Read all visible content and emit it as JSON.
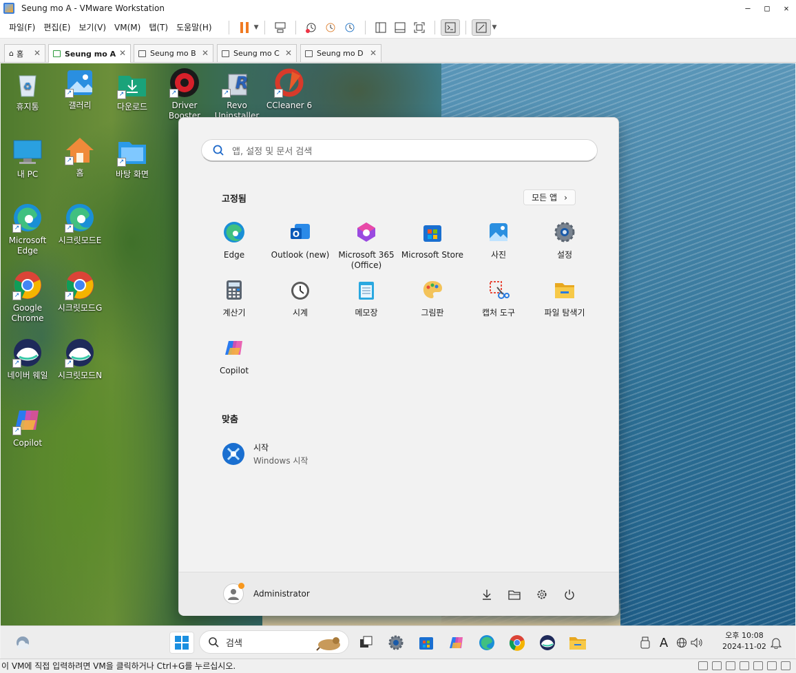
{
  "window": {
    "title": "Seung mo A - VMware Workstation"
  },
  "menu": [
    "파일(F)",
    "편집(E)",
    "보기(V)",
    "VM(M)",
    "탭(T)",
    "도움말(H)"
  ],
  "tabs": [
    {
      "label": "홈",
      "active": false
    },
    {
      "label": "Seung mo A",
      "active": true
    },
    {
      "label": "Seung mo B",
      "active": false
    },
    {
      "label": "Seung mo C",
      "active": false
    },
    {
      "label": "Seung mo D",
      "active": false
    }
  ],
  "desktop_icons": [
    {
      "label": "휴지통",
      "icon": "recycle-bin-icon"
    },
    {
      "label": "갤러리",
      "icon": "gallery-icon"
    },
    {
      "label": "다운로드",
      "icon": "downloads-folder-icon"
    },
    {
      "label": "Driver Booster",
      "icon": "driver-booster-icon"
    },
    {
      "label": "Revo Uninstaller",
      "icon": "revo-uninstaller-icon"
    },
    {
      "label": "CCleaner 6",
      "icon": "ccleaner-icon"
    },
    {
      "label": "내 PC",
      "icon": "this-pc-icon"
    },
    {
      "label": "홈",
      "icon": "home-icon"
    },
    {
      "label": "바탕 화면",
      "icon": "desktop-folder-icon"
    },
    {
      "label": "Microsoft Edge",
      "icon": "edge-icon"
    },
    {
      "label": "시크릿모드E",
      "icon": "edge-icon"
    },
    {
      "label": "Google Chrome",
      "icon": "chrome-icon"
    },
    {
      "label": "시크릿모드G",
      "icon": "chrome-icon"
    },
    {
      "label": "네이버 웨일",
      "icon": "whale-icon"
    },
    {
      "label": "시크릿모드N",
      "icon": "whale-icon"
    },
    {
      "label": "Copilot",
      "icon": "copilot-icon"
    }
  ],
  "start": {
    "search_placeholder": "앱, 설정 및 문서 검색",
    "pinned_title": "고정됨",
    "all_apps": "모든 앱",
    "all_apps_chevron": "›",
    "pinned": [
      {
        "label": "Edge",
        "icon": "edge-icon"
      },
      {
        "label": "Outlook (new)",
        "icon": "outlook-icon"
      },
      {
        "label": "Microsoft 365 (Office)",
        "icon": "m365-icon"
      },
      {
        "label": "Microsoft Store",
        "icon": "store-icon"
      },
      {
        "label": "사진",
        "icon": "photos-icon"
      },
      {
        "label": "설정",
        "icon": "settings-gear-icon"
      },
      {
        "label": "계산기",
        "icon": "calculator-icon"
      },
      {
        "label": "시계",
        "icon": "clock-icon"
      },
      {
        "label": "메모장",
        "icon": "notepad-icon"
      },
      {
        "label": "그림판",
        "icon": "paint-icon"
      },
      {
        "label": "캡처 도구",
        "icon": "snipping-tool-icon"
      },
      {
        "label": "파일 탐색기",
        "icon": "file-explorer-icon"
      },
      {
        "label": "Copilot",
        "icon": "copilot-icon"
      }
    ],
    "recommended_title": "맞춤",
    "recommended": [
      {
        "title": "시작",
        "subtitle": "Windows 시작",
        "icon": "get-started-icon"
      }
    ],
    "user_name": "Administrator"
  },
  "taskbar": {
    "search_label": "검색",
    "clock_time": "오후 10:08",
    "clock_date": "2024-11-02",
    "ime": "A"
  },
  "status_text": "이 VM에 직접 입력하려면 VM을 클릭하거나 Ctrl+G를 누르십시오."
}
